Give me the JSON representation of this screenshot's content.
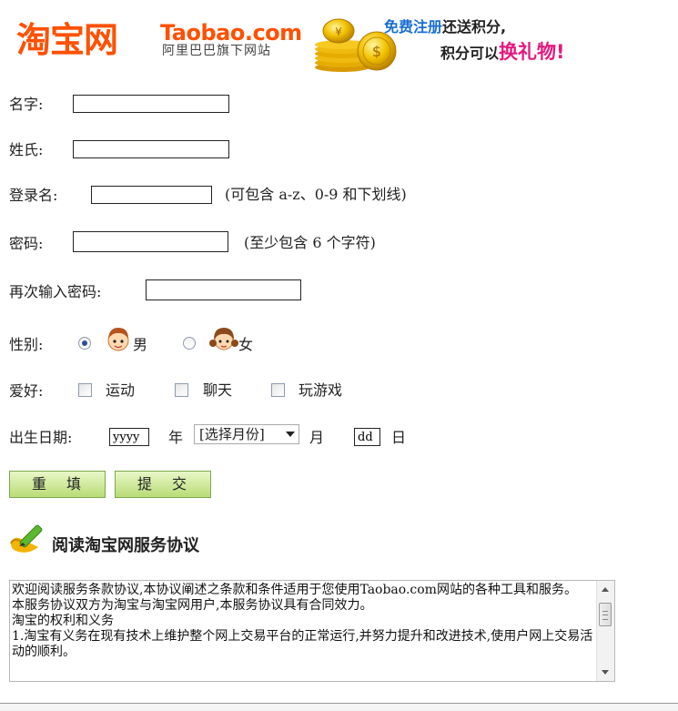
{
  "header": {
    "logo_cn": "淘宝网",
    "logo_en": "Taobao.com",
    "logo_sub": "阿里巴巴旗下网站",
    "promo_free": "免费注册",
    "promo_rest": "还送积分,",
    "promo_line2_a": "积分可以",
    "promo_line2_b": "换礼物",
    "promo_line2_c": "!",
    "brand_color": "#ff5000",
    "coins_icon": "gold-coins-icon"
  },
  "form": {
    "first_name_label": "名字:",
    "last_name_label": "姓氏:",
    "login_label": "登录名:",
    "login_hint": "(可包含 a-z、0-9 和下划线)",
    "password_label": "密码:",
    "password_hint": "(至少包含 6 个字符)",
    "confirm_label": "再次输入密码:",
    "gender_label": "性别:",
    "gender_male": "男",
    "gender_female": "女",
    "gender_selected": "男",
    "hobby_label": "爱好:",
    "hobbies": [
      "运动",
      "聊天",
      "玩游戏"
    ],
    "birth_label": "出生日期:",
    "year_value": "yyyy",
    "year_unit": "年",
    "month_select": "[选择月份]",
    "month_unit": "月",
    "day_value": "dd",
    "day_unit": "日",
    "reset_button": "重填",
    "submit_button": "提交",
    "button_color": "#b9dc76"
  },
  "agreement": {
    "title": "阅读淘宝网服务协议",
    "pencil_icon": "pencil-icon",
    "lines": [
      "欢迎阅读服务条款协议,本协议阐述之条款和条件适用于您使用Taobao.com网站的各种工具和服务。",
      "本服务协议双方为淘宝与淘宝网用户,本服务协议具有合同效力。",
      "淘宝的权利和义务",
      "1.淘宝有义务在现有技术上维护整个网上交易平台的正常运行,并努力提升和改进技术,使用户网上交易活动的顺利。"
    ]
  }
}
